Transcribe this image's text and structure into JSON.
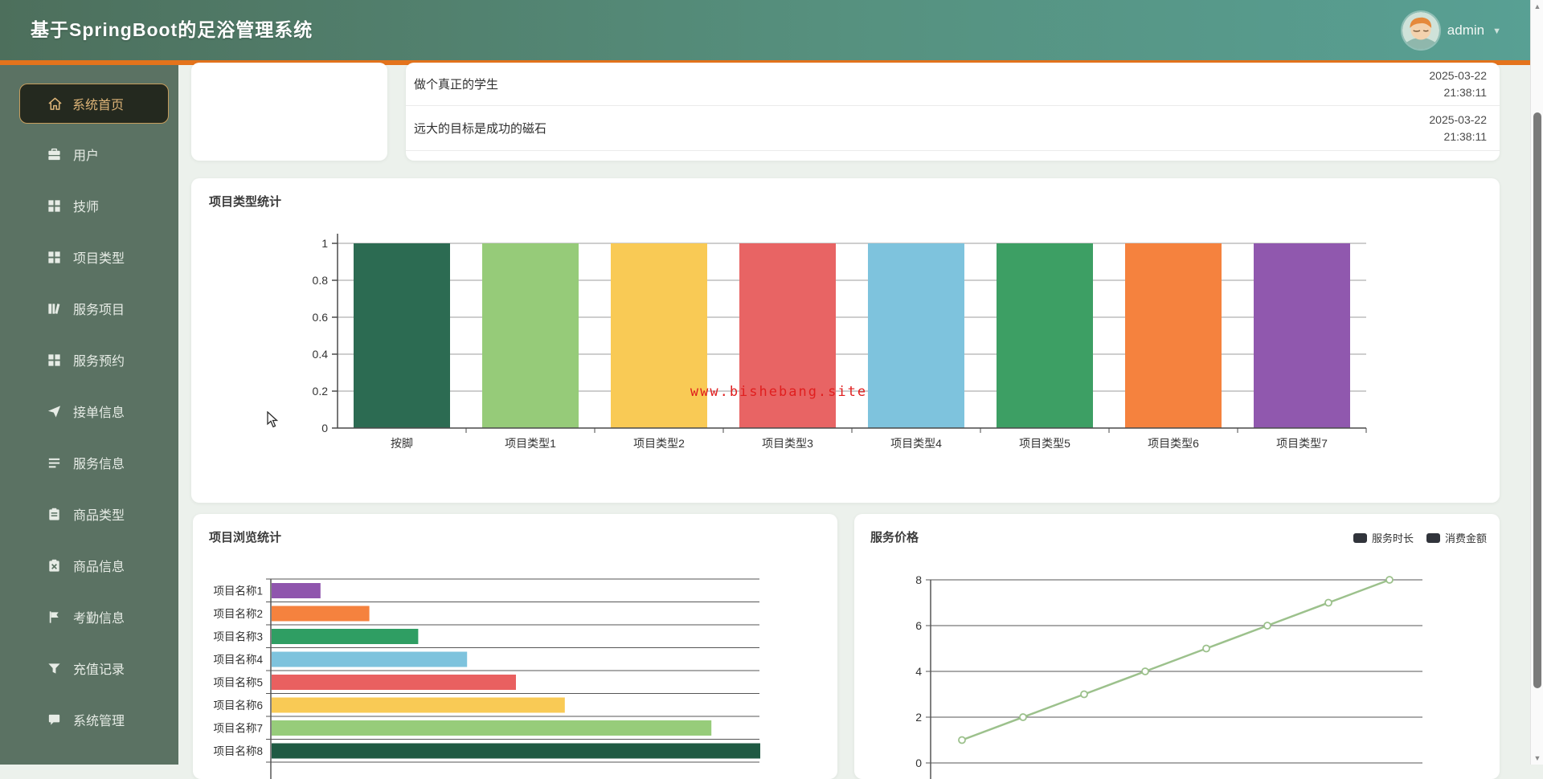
{
  "header": {
    "title": "基于SpringBoot的足浴管理系统",
    "username": "admin",
    "caret": "▼"
  },
  "sidebar": {
    "items": [
      {
        "label": "系统首页",
        "icon": "home-icon",
        "active": true
      },
      {
        "label": "用户",
        "icon": "briefcase-icon",
        "active": false
      },
      {
        "label": "技师",
        "icon": "grid-icon",
        "active": false
      },
      {
        "label": "项目类型",
        "icon": "grid-icon",
        "active": false
      },
      {
        "label": "服务项目",
        "icon": "book-icon",
        "active": false
      },
      {
        "label": "服务预约",
        "icon": "grid-icon",
        "active": false
      },
      {
        "label": "接单信息",
        "icon": "paper-plane-icon",
        "active": false
      },
      {
        "label": "服务信息",
        "icon": "list-icon",
        "active": false
      },
      {
        "label": "商品类型",
        "icon": "clipboard-icon",
        "active": false
      },
      {
        "label": "商品信息",
        "icon": "clipboard-x-icon",
        "active": false
      },
      {
        "label": "考勤信息",
        "icon": "flag-icon",
        "active": false
      },
      {
        "label": "充值记录",
        "icon": "funnel-icon",
        "active": false
      },
      {
        "label": "系统管理",
        "icon": "chat-icon",
        "active": false
      }
    ]
  },
  "quotes": {
    "rows": [
      {
        "text": "做个真正的学生",
        "date": "2025-03-22",
        "time": "21:38:11"
      },
      {
        "text": "远大的目标是成功的磁石",
        "date": "2025-03-22",
        "time": "21:38:11"
      }
    ]
  },
  "watermark": "www.bishebang.site",
  "colors": {
    "accent_orange": "#e4731c",
    "sidebar_green": "#5b7263",
    "active_item_text": "#dcb377",
    "watermark_red": "#e01f1f"
  },
  "chart_data": [
    {
      "type": "bar",
      "orientation": "vertical",
      "title": "项目类型统计",
      "categories": [
        "按脚",
        "项目类型1",
        "项目类型2",
        "项目类型3",
        "项目类型4",
        "项目类型5",
        "项目类型6",
        "项目类型7"
      ],
      "values": [
        1,
        1,
        1,
        1,
        1,
        1,
        1,
        1
      ],
      "bar_colors": [
        "#2c6b52",
        "#96cb79",
        "#f9ca55",
        "#e86464",
        "#7ec3dd",
        "#3d9f64",
        "#f5823e",
        "#9058ae"
      ],
      "ylim": [
        0,
        1
      ],
      "yticks": [
        0,
        0.2,
        0.4,
        0.6,
        0.8,
        1
      ],
      "grid": true,
      "legend": null
    },
    {
      "type": "bar",
      "orientation": "horizontal",
      "title": "项目浏览统计",
      "categories": [
        "项目名称1",
        "项目名称2",
        "项目名称3",
        "项目名称4",
        "项目名称5",
        "项目名称6",
        "项目名称7",
        "项目名称8"
      ],
      "values": [
        1,
        2,
        3,
        4,
        5,
        6,
        9,
        10
      ],
      "bar_colors": [
        "#8f55ad",
        "#f5823e",
        "#2f9e63",
        "#7ec3dd",
        "#e96060",
        "#f9ca55",
        "#97cc7a",
        "#1f5a43"
      ],
      "xlim": [
        0,
        10
      ],
      "grid": true,
      "legend": null
    },
    {
      "type": "line",
      "title": "服务价格",
      "legend": [
        "服务时长",
        "消费金额"
      ],
      "legend_position": "top-right",
      "x": [
        1,
        2,
        3,
        4,
        5,
        6,
        7,
        8
      ],
      "series": [
        {
          "name": "服务价格",
          "values": [
            1,
            2,
            3,
            4,
            5,
            6,
            7,
            8
          ]
        }
      ],
      "ylim": [
        0,
        8
      ],
      "yticks": [
        0,
        2,
        4,
        6,
        8
      ],
      "line_color": "#9cc18c",
      "grid": true
    }
  ]
}
